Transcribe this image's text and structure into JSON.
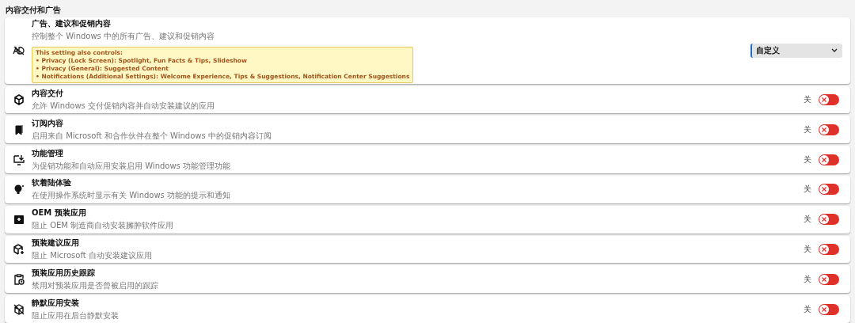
{
  "section_title": "内容交付和广告",
  "main_setting": {
    "title": "广告、建议和促销内容",
    "description": "控制整个 Windows 中的所有广告、建议和促销内容",
    "notice": {
      "heading": "This setting also controls:",
      "lines": [
        "• Privacy (Lock Screen): Spotlight, Fun Facts & Tips, Slideshow",
        "• Privacy (General): Suggested Content",
        "• Notifications (Additional Settings): Welcome Experience, Tips & Suggestions, Notification Center Suggestions"
      ]
    },
    "dropdown": {
      "value": "自定义"
    }
  },
  "settings": [
    {
      "title": "内容交付",
      "description": "允许 Windows 交付促销内容并自动安装建议的应用",
      "state_label": "关",
      "on": false
    },
    {
      "title": "订阅内容",
      "description": "启用来自 Microsoft 和合作伙伴在整个 Windows 中的促销内容订阅",
      "state_label": "关",
      "on": false
    },
    {
      "title": "功能管理",
      "description": "为促销功能和自动应用安装启用 Windows 功能管理功能",
      "state_label": "关",
      "on": false
    },
    {
      "title": "软着陆体验",
      "description": "在使用操作系统时显示有关 Windows 功能的提示和通知",
      "state_label": "关",
      "on": false
    },
    {
      "title": "OEM 预装应用",
      "description": "阻止 OEM 制造商自动安装臃肿软件应用",
      "state_label": "关",
      "on": false
    },
    {
      "title": "预装建议应用",
      "description": "阻止 Microsoft 自动安装建议应用",
      "state_label": "关",
      "on": false
    },
    {
      "title": "预装应用历史跟踪",
      "description": "禁用对预装应用是否曾被启用的跟踪",
      "state_label": "关",
      "on": false
    },
    {
      "title": "静默应用安装",
      "description": "阻止应用在后台静默安装",
      "state_label": "关",
      "on": false
    }
  ]
}
